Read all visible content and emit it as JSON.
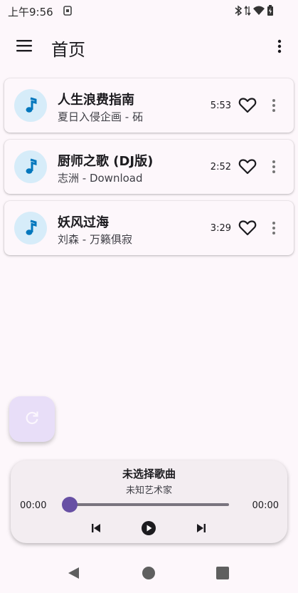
{
  "status_bar": {
    "time": "上午9:56",
    "icons": [
      "sim-icon",
      "bluetooth-icon",
      "data-arrows-icon",
      "wifi-icon",
      "battery-icon"
    ]
  },
  "app_bar": {
    "title": "首页",
    "icons": [
      "menu-icon",
      "overflow-menu-icon"
    ]
  },
  "songs": [
    {
      "title": "人生浪费指南",
      "subtitle": "夏日入侵企画 - 砳",
      "duration": "5:53"
    },
    {
      "title": "厨师之歌 (DJ版)",
      "subtitle": "志洲 - Download",
      "duration": "2:52"
    },
    {
      "title": "妖风过海",
      "subtitle": "刘森 - 万籁俱寂",
      "duration": "3:29"
    }
  ],
  "song_icons": [
    "music-note-icon",
    "heart-icon",
    "more-vert-icon"
  ],
  "fab": {
    "icon": "refresh-icon"
  },
  "player": {
    "title": "未选择歌曲",
    "artist": "未知艺术家",
    "current_time": "00:00",
    "total_time": "00:00",
    "progress": 0,
    "icons": [
      "skip-previous-icon",
      "play-icon",
      "skip-next-icon"
    ]
  },
  "colors": {
    "background": "#fdf7fb",
    "accent": "#6750a4",
    "music_icon": "#0277bd",
    "avatar_bg": "#d6ecf9",
    "fab_bg": "#e8def8"
  }
}
